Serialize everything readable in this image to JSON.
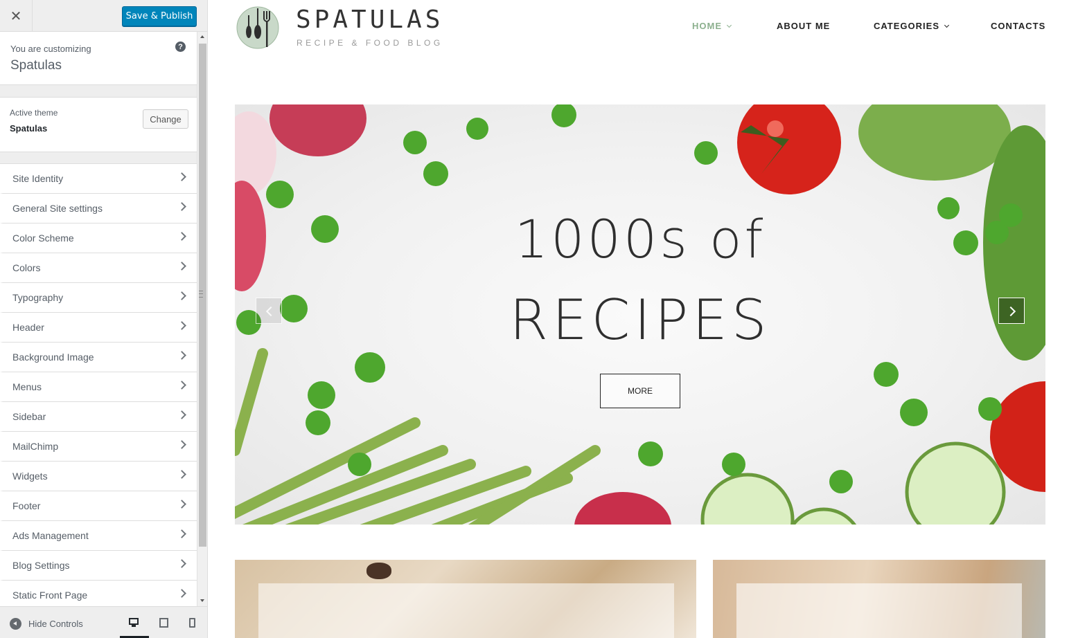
{
  "customizer": {
    "close_icon": "close-icon",
    "publish_label": "Save & Publish",
    "customizing_label": "You are customizing",
    "site_name": "Spatulas",
    "help_glyph": "?",
    "active_theme_label": "Active theme",
    "active_theme_name": "Spatulas",
    "change_label": "Change",
    "sections": [
      {
        "label": "Site Identity"
      },
      {
        "label": "General Site settings"
      },
      {
        "label": "Color Scheme"
      },
      {
        "label": "Colors"
      },
      {
        "label": "Typography"
      },
      {
        "label": "Header"
      },
      {
        "label": "Background Image"
      },
      {
        "label": "Menus"
      },
      {
        "label": "Sidebar"
      },
      {
        "label": "MailChimp"
      },
      {
        "label": "Widgets"
      },
      {
        "label": "Footer"
      },
      {
        "label": "Ads Management"
      },
      {
        "label": "Blog Settings"
      },
      {
        "label": "Static Front Page"
      }
    ],
    "hide_controls_label": "Hide Controls",
    "devices": [
      "desktop-icon",
      "tablet-icon",
      "mobile-icon"
    ],
    "publish_color": "#0085ba"
  },
  "site": {
    "brand": "SPATULAS",
    "tagline": "RECIPE & FOOD BLOG",
    "nav": {
      "home": "HOME",
      "about": "ABOUT ME",
      "categories": "CATEGORIES",
      "contacts": "CONTACTS"
    },
    "active_nav_color": "#8cb08e",
    "hero": {
      "title_line1": "1000s of",
      "title_line2": "RECIPES",
      "button_label": "MORE"
    }
  }
}
